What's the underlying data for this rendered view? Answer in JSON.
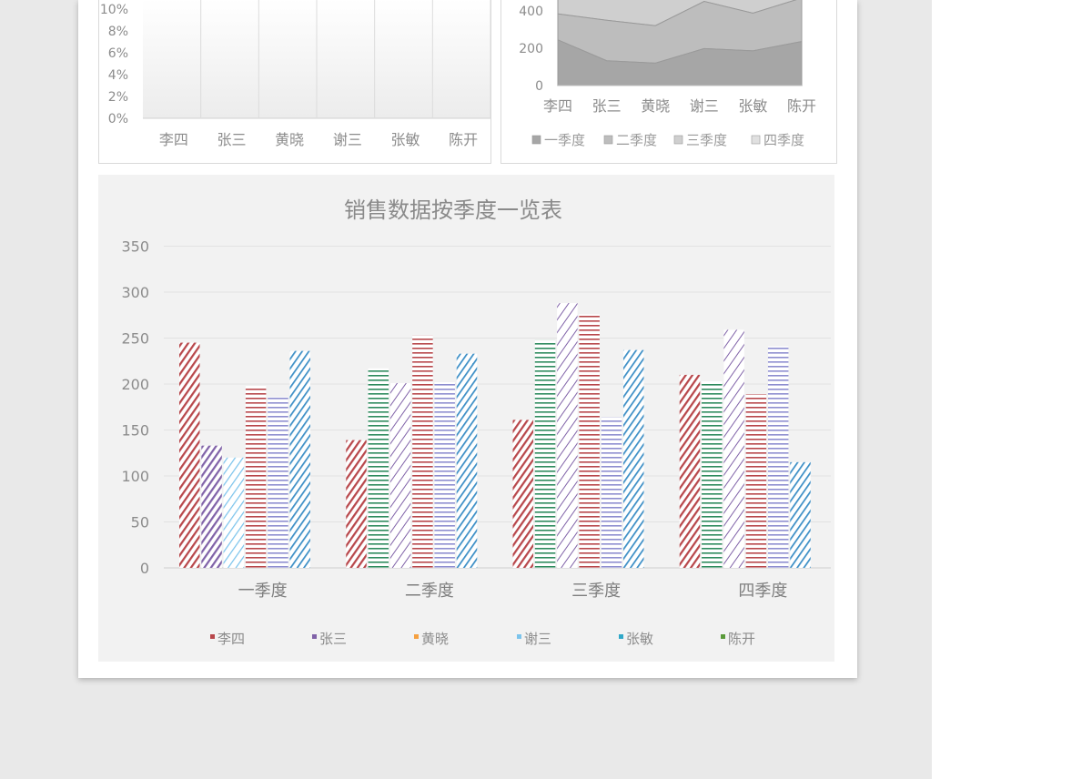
{
  "colors": {
    "li_si": "#b8474b",
    "zhang_san": "#8062a8",
    "huang_xiao": "#ffffff",
    "xie_san": "#2e8b5e",
    "zhang_min": "#8e8ed0",
    "chen_kai": "#3d8fc6",
    "light_blue": "#7cc4ec",
    "grid": "#e3e3e3",
    "axis_text": "#8c8c8c",
    "title_text": "#8a8a8a"
  },
  "chart_data": [
    {
      "type": "bar",
      "id": "percent-chart",
      "title": "",
      "categories": [
        "李四",
        "张三",
        "黄晓",
        "谢三",
        "张敏",
        "陈开"
      ],
      "yticks": [
        "0%",
        "2%",
        "4%",
        "6%",
        "8%",
        "10%"
      ],
      "ylim": [
        0,
        10
      ],
      "grid": true
    },
    {
      "type": "area",
      "id": "stacked-area-chart",
      "title": "",
      "categories": [
        "李四",
        "张三",
        "黄晓",
        "谢三",
        "张敏",
        "陈开"
      ],
      "yticks": [
        "0",
        "200",
        "400"
      ],
      "ylim": [
        0,
        400
      ],
      "series": [
        {
          "name": "一季度",
          "values": [
            245,
            133,
            120,
            198,
            186,
            236
          ],
          "color": "#a6a6a6"
        },
        {
          "name": "二季度",
          "values": [
            139,
            217,
            201,
            253,
            202,
            233
          ],
          "color": "#bdbdbd"
        },
        {
          "name": "三季度",
          "values": [
            161,
            248,
            288,
            276,
            164,
            237
          ],
          "color": "#cfcfcf"
        },
        {
          "name": "四季度",
          "values": [
            210,
            203,
            259,
            189,
            241,
            115
          ],
          "color": "#e0e0e0"
        }
      ],
      "legend": [
        "一季度",
        "二季度",
        "三季度",
        "四季度"
      ],
      "legend_position": "bottom"
    },
    {
      "type": "bar",
      "id": "quarter-bar-chart",
      "title": "销售数据按季度一览表",
      "categories": [
        "一季度",
        "二季度",
        "三季度",
        "四季度"
      ],
      "yticks": [
        "0",
        "50",
        "100",
        "150",
        "200",
        "250",
        "300",
        "350"
      ],
      "ylim": [
        0,
        350
      ],
      "grid": true,
      "legend_position": "bottom",
      "legend": [
        "李四",
        "张三",
        "黄晓",
        "谢三",
        "张敏",
        "陈开"
      ],
      "values": [
        [
          245,
          133,
          120,
          198,
          186,
          236
        ],
        [
          139,
          217,
          201,
          253,
          202,
          233
        ],
        [
          161,
          248,
          288,
          276,
          164,
          237
        ],
        [
          210,
          203,
          259,
          189,
          241,
          115
        ]
      ]
    }
  ]
}
